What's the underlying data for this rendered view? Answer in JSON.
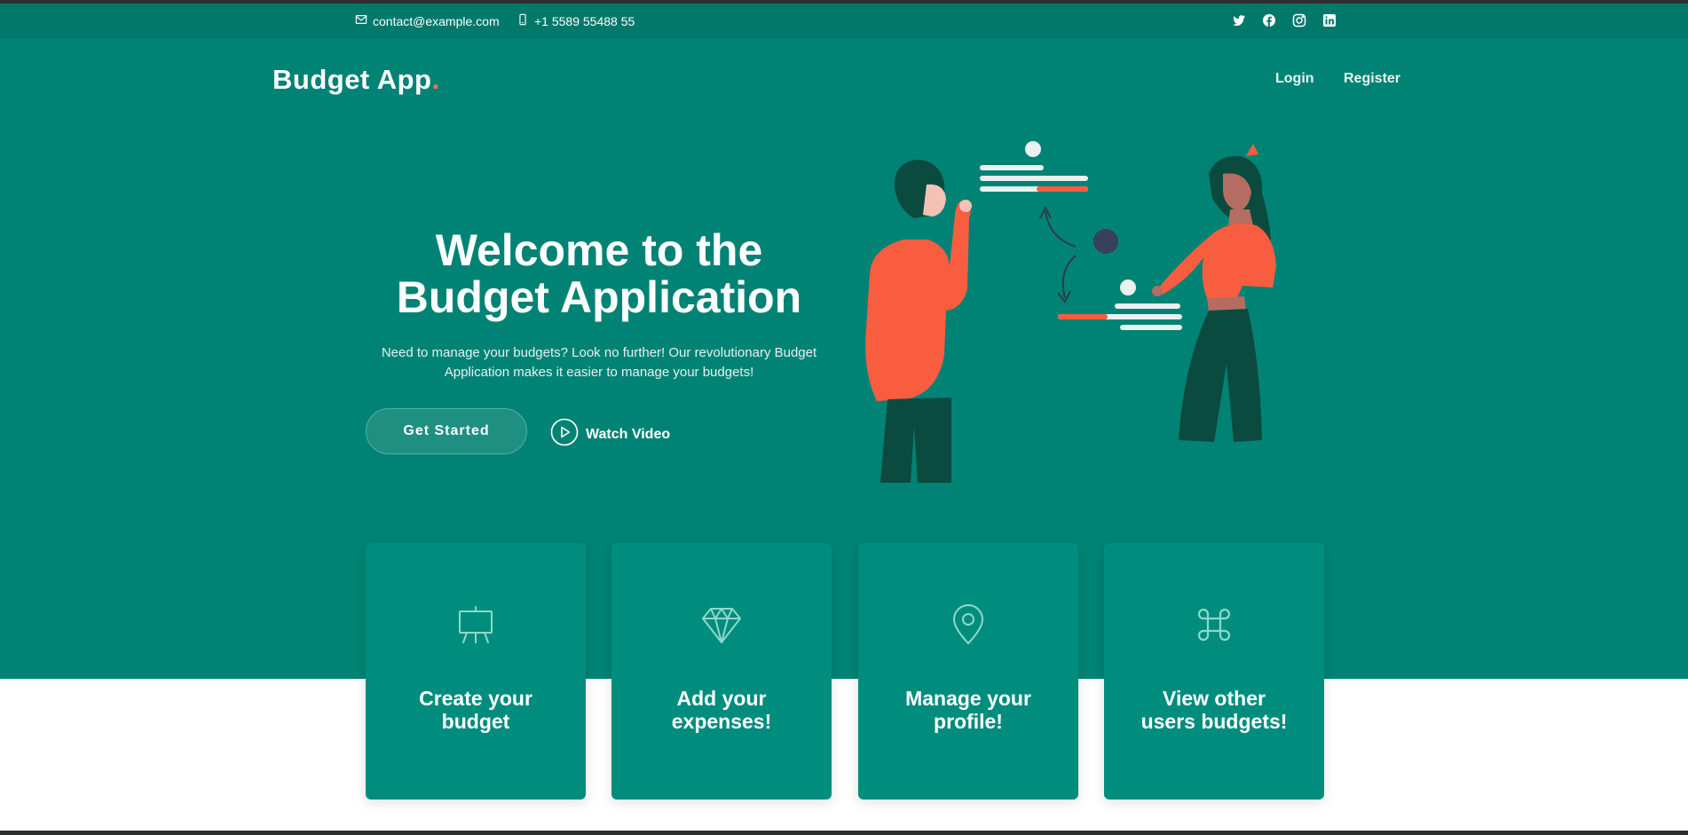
{
  "topbar": {
    "email": "contact@example.com",
    "phone": "+1 5589 55488 55",
    "socials": [
      "twitter-icon",
      "facebook-icon",
      "instagram-icon",
      "linkedin-icon"
    ]
  },
  "header": {
    "brand": "Budget App",
    "brand_dot": ".",
    "nav": {
      "login": "Login",
      "register": "Register"
    }
  },
  "hero": {
    "headline_line1": "Welcome to the",
    "headline_line2": "Budget Application",
    "intro_line1": "Need to manage your budgets? Look no further! Our revolutionary Budget",
    "intro_line2": "Application makes it easier to manage your budgets!",
    "cta_label": "Get Started",
    "video_label": "Watch Video"
  },
  "features": [
    {
      "icon": "easel-icon",
      "line1": "Create your",
      "line2": "budget"
    },
    {
      "icon": "gem-icon",
      "line1": "Add your",
      "line2": "expenses!"
    },
    {
      "icon": "map-pin-icon",
      "line1": "Manage your",
      "line2": "profile!"
    },
    {
      "icon": "command-icon",
      "line1": "View other",
      "line2": "users budgets!"
    }
  ],
  "colors": {
    "topbar": "#00796b",
    "hero": "#008374",
    "card": "#008d7d",
    "accent": "#f96f59",
    "dark_green": "#0b4a3f"
  }
}
